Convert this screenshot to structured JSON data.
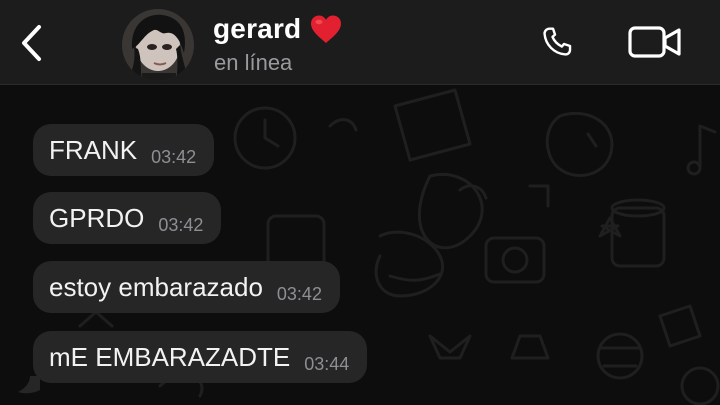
{
  "header": {
    "contact_name": "gerard",
    "status": "en línea",
    "icons": {
      "back": "chevron-left-icon",
      "heart": "red-heart-emoji",
      "call": "phone-icon",
      "video": "video-camera-icon"
    },
    "colors": {
      "bar": "#1c1c1d",
      "name": "#ffffff",
      "status": "#9a9a9e",
      "heart": "#e3202f"
    }
  },
  "messages": [
    {
      "text": "FRANK",
      "time": "03:42"
    },
    {
      "text": "GPRDO",
      "time": "03:42"
    },
    {
      "text": "estoy embarazado",
      "time": "03:42"
    },
    {
      "text": "mE EMBARAZADTE",
      "time": "03:44"
    }
  ],
  "colors": {
    "bubble": "#262627",
    "message_text": "#f2f2f2",
    "timestamp": "#8e8e93",
    "chat_background": "#0d0d0d"
  }
}
